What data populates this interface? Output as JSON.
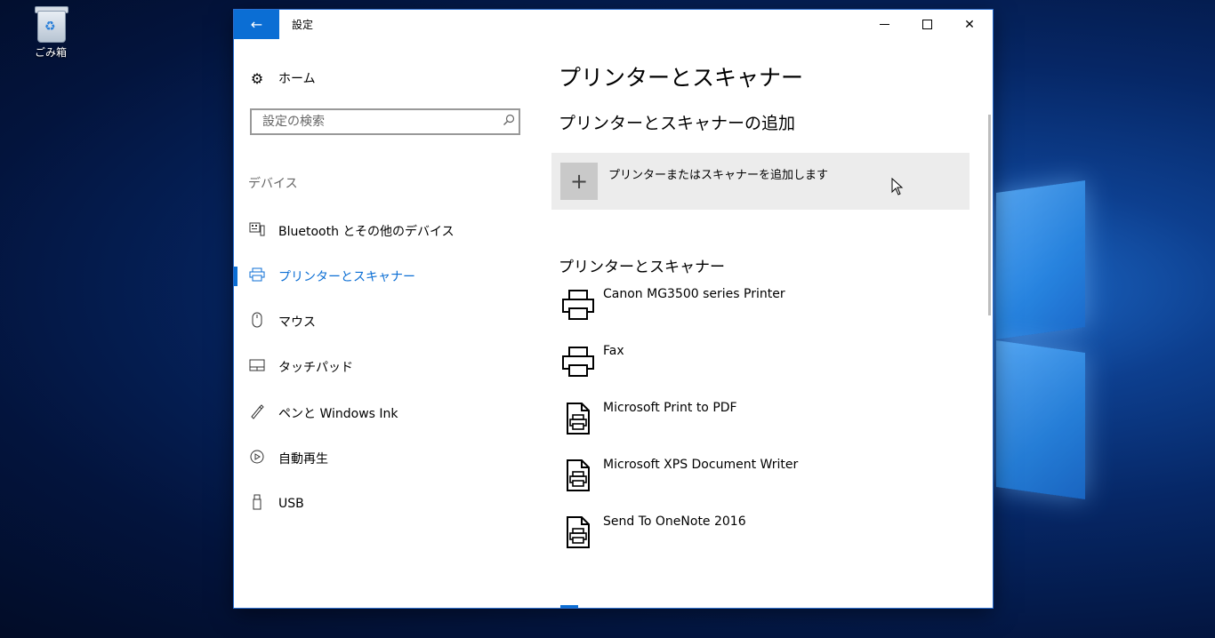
{
  "desktop": {
    "recycle_bin_label": "ごみ箱"
  },
  "window": {
    "title": "設定",
    "back_glyph": "←",
    "close_glyph": "✕",
    "accent": "#0b6ed4"
  },
  "sidebar": {
    "home_label": "ホーム",
    "search_placeholder": "設定の検索",
    "section_label": "デバイス",
    "items": [
      {
        "label": "Bluetooth とその他のデバイス",
        "icon": "bluetooth-devices-icon"
      },
      {
        "label": "プリンターとスキャナー",
        "icon": "printer-icon",
        "active": true
      },
      {
        "label": "マウス",
        "icon": "mouse-icon"
      },
      {
        "label": "タッチパッド",
        "icon": "touchpad-icon"
      },
      {
        "label": "ペンと Windows Ink",
        "icon": "pen-icon"
      },
      {
        "label": "自動再生",
        "icon": "autoplay-icon"
      },
      {
        "label": "USB",
        "icon": "usb-icon"
      }
    ]
  },
  "main": {
    "page_title": "プリンターとスキャナー",
    "add_heading": "プリンターとスキャナーの追加",
    "add_label": "プリンターまたはスキャナーを追加します",
    "list_heading": "プリンターとスキャナー",
    "printers": [
      {
        "name": "Canon MG3500 series Printer",
        "icon": "printer-icon"
      },
      {
        "name": "Fax",
        "icon": "printer-icon"
      },
      {
        "name": "Microsoft Print to PDF",
        "icon": "document-printer-icon"
      },
      {
        "name": "Microsoft XPS Document Writer",
        "icon": "document-printer-icon"
      },
      {
        "name": "Send To OneNote 2016",
        "icon": "document-printer-icon"
      }
    ]
  }
}
